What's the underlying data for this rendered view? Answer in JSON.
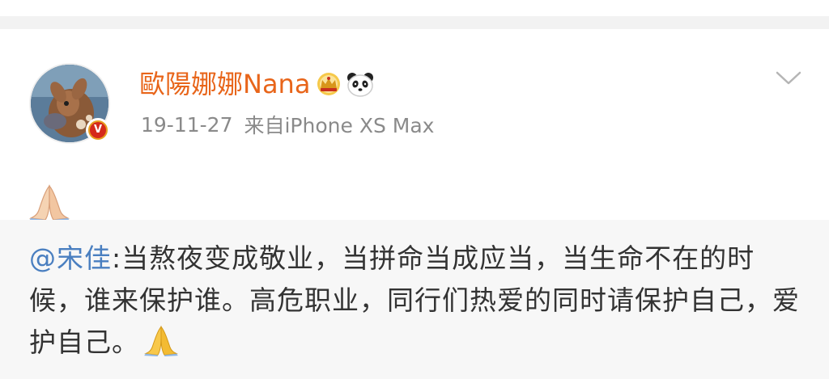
{
  "post": {
    "username": "歐陽娜娜Nana",
    "time": "19-11-27",
    "source": "来自iPhone XS Max",
    "badge_letter": "V",
    "body_emoji": "pray-emoji",
    "icons": [
      "crown-icon",
      "panda-icon",
      "chevron-down-icon",
      "verified-badge-icon",
      "pray-emoji"
    ]
  },
  "repost": {
    "mention": "@宋佳",
    "separator": ":",
    "text": "当熬夜变成敬业，当拼命当成应当，当生命不在的时候，谁来保护谁。高危职业，同行们热爱的同时请保护自己，爱护自己。"
  },
  "colors": {
    "username": "#e8651a",
    "meta": "#8a8a8a",
    "mention": "#4a7fc0",
    "repost_bg": "#f7f7f7",
    "divider": "#f2f2f2",
    "badge_red": "#d52a1a",
    "badge_gold": "#e8a020"
  }
}
